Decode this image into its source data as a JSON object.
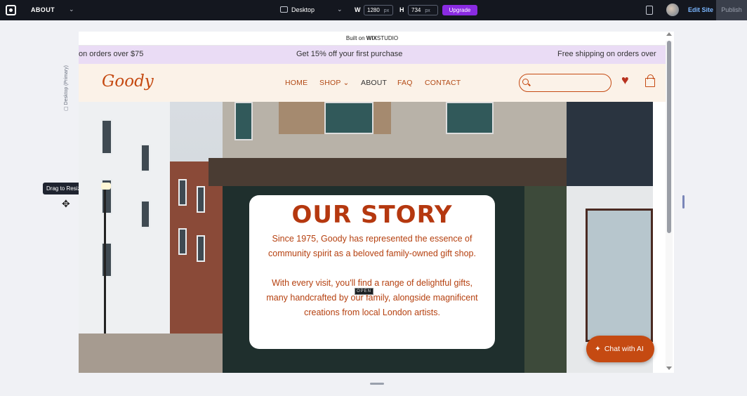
{
  "editor": {
    "page_name": "ABOUT",
    "device": "Desktop",
    "width_label": "W",
    "width_value": "1280",
    "height_label": "H",
    "height_value": "734",
    "unit": "px",
    "upgrade": "Upgrade",
    "edit_site": "Edit Site",
    "publish": "Publish",
    "side_label": "Desktop (Primary)",
    "tooltip": "Drag to Resize"
  },
  "site": {
    "built_on_prefix": "Built on",
    "built_on_brand": "WIX",
    "built_on_suffix": "STUDIO",
    "promo": [
      "on orders over $75",
      "Get 15% off your first purchase",
      "Free shipping on orders over"
    ],
    "brand": "Goody",
    "nav": [
      "HOME",
      "SHOP",
      "ABOUT",
      "FAQ",
      "CONTACT"
    ],
    "shop_chevron": "⌄",
    "hero": {
      "title": "OUR STORY",
      "paragraph1": "Since 1975, Goody has represented the essence of community spirit as a beloved family-owned gift shop.",
      "paragraph2": "With every visit, you'll find a range of delightful gifts, many handcrafted by our family, alongside magnificent creations from local London artists.",
      "sign": "OPEN"
    },
    "chat": "Chat with AI"
  },
  "colors": {
    "accent": "#c54a12",
    "promo_bg": "#eadcf5",
    "header_bg": "#fbf2e8",
    "upgrade": "#8a2be2"
  }
}
